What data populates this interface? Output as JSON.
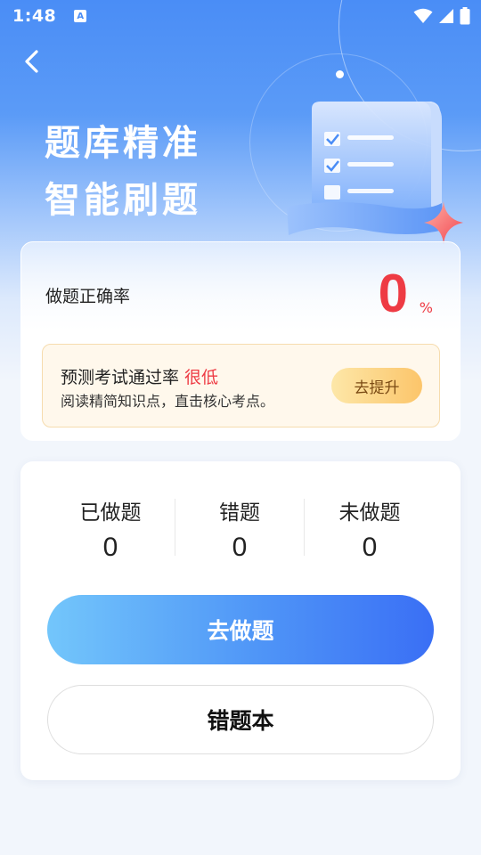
{
  "status_bar": {
    "time": "1:48",
    "notification_glyph": "A"
  },
  "header": {
    "title_line1": "题库精准",
    "title_line2": "智能刷题"
  },
  "accuracy": {
    "label": "做题正确率",
    "value": "0",
    "unit": "%"
  },
  "prediction": {
    "label": "预测考试通过率",
    "level": "很低",
    "subtitle": "阅读精简知识点，直击核心考点。",
    "button_label": "去提升"
  },
  "stats": [
    {
      "label": "已做题",
      "value": "0"
    },
    {
      "label": "错题",
      "value": "0"
    },
    {
      "label": "未做题",
      "value": "0"
    }
  ],
  "actions": {
    "primary_label": "去做题",
    "secondary_label": "错题本"
  },
  "colors": {
    "brand_blue": "#4a8df6",
    "alert_red": "#ee3b44",
    "improve_gold": "#fcc56a"
  },
  "icons": [
    "back-arrow-icon",
    "wifi-icon",
    "signal-icon",
    "battery-icon",
    "checklist-scroll-icon",
    "sparkle-star-icon"
  ]
}
